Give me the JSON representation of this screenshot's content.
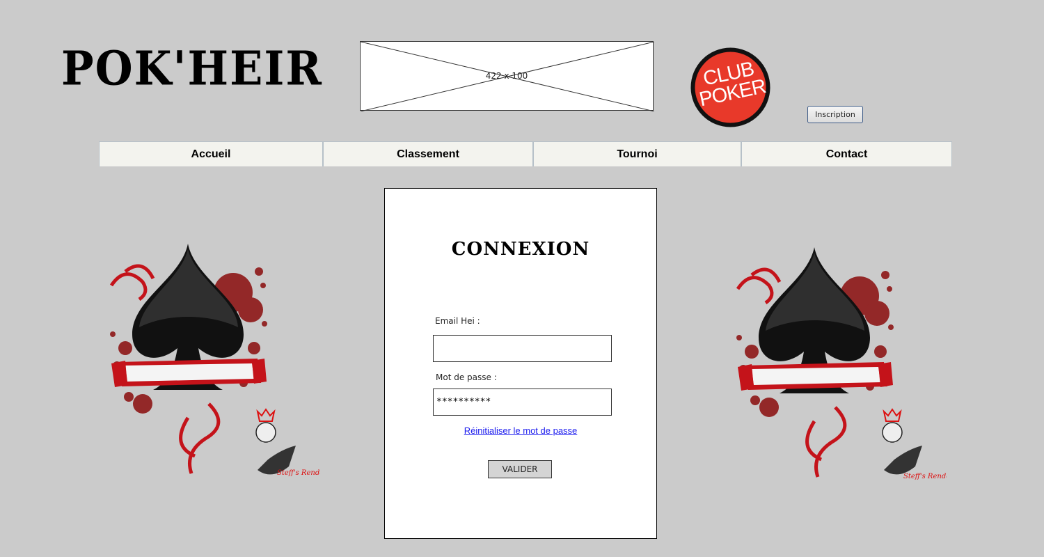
{
  "header": {
    "logo_text": "POK'HEIR",
    "placeholder_label": "422 x 100",
    "club_logo_line1": "CLUB",
    "club_logo_line2": "POKER",
    "inscription_label": "Inscription"
  },
  "nav": {
    "items": [
      {
        "label": "Accueil"
      },
      {
        "label": "Classement"
      },
      {
        "label": "Tournoi"
      },
      {
        "label": "Contact"
      }
    ]
  },
  "login": {
    "title": "CONNEXION",
    "email_label": "Email Hei :",
    "email_value": "",
    "password_label": "Mot de passe  :",
    "password_value": "**********",
    "reset_link": "Réinitialiser le mot de passe",
    "submit_label": "VALIDER"
  },
  "decor": {
    "signature": "Steff's Render"
  },
  "colors": {
    "background": "#cbcbcb",
    "club_logo_red": "#e8392a",
    "link": "#1a1aee",
    "nav_bg": "#f3f3ee"
  }
}
